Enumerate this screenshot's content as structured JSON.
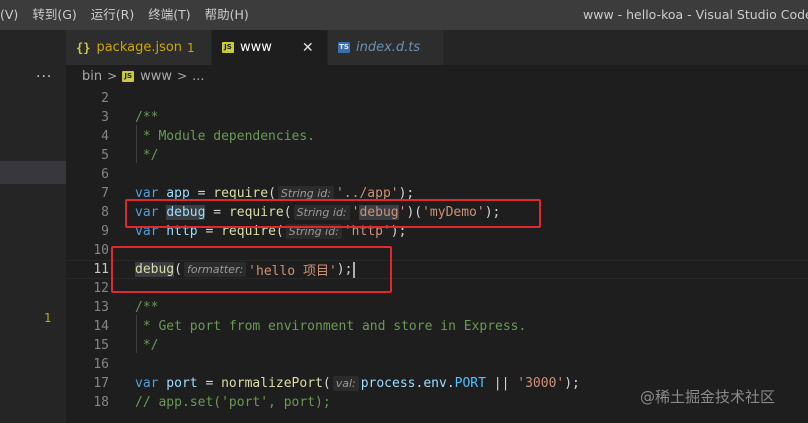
{
  "menu": {
    "items": [
      "(V)",
      "转到(G)",
      "运行(R)",
      "终端(T)",
      "帮助(H)"
    ]
  },
  "window_title": "www - hello-koa - Visual Studio Code [管",
  "sidebar": {
    "more_label": "···"
  },
  "tabs": [
    {
      "icon": "{}",
      "label": "package.json",
      "badge": "1"
    },
    {
      "icon": "JS",
      "label": "www",
      "close": "✕"
    },
    {
      "icon": "TS",
      "label": "index.d.ts"
    }
  ],
  "breadcrumb": {
    "root": "bin",
    "sep1": ">",
    "file_icon": "JS",
    "file": "www",
    "sep2": ">",
    "tail": "..."
  },
  "gutter_marker": "1",
  "code": {
    "ln2": "2",
    "ln3": "3",
    "l3_text": "/**",
    "ln4": "4",
    "l4_text": " * Module dependencies.",
    "ln5": "5",
    "l5_text": " */",
    "ln6": "6",
    "ln7": "7",
    "l7_var": "var",
    "l7_name": " app",
    "l7_eq": " = ",
    "l7_fn": "require",
    "l7_open": "(",
    "l7_hint": "String id:",
    "l7_str": "'../app'",
    "l7_close": ");",
    "ln8": "8",
    "l8_var": "var",
    "l8_name": "debug",
    "l8_eq": " = ",
    "l8_fn": "require",
    "l8_open": "(",
    "l8_hint": "String id:",
    "l8_q1": "'",
    "l8_strmid": "debug",
    "l8_q2": "'",
    "l8_call": ")(",
    "l8_str2": "'myDemo'",
    "l8_close": ");",
    "ln9": "9",
    "l9_var": "var",
    "l9_name": " http",
    "l9_eq": " = ",
    "l9_fn": "require",
    "l9_open": "(",
    "l9_hint": "String id:",
    "l9_str": "'http'",
    "l9_close": ");",
    "ln10": "10",
    "ln11": "11",
    "l11_fn": "debug",
    "l11_open": "(",
    "l11_hint": "formatter:",
    "l11_str": "'hello 项目'",
    "l11_close": ");",
    "ln12": "12",
    "ln13": "13",
    "l13_text": "/**",
    "ln14": "14",
    "l14_text": " * Get port from environment and store in Express.",
    "ln15": "15",
    "l15_text": " */",
    "ln16": "16",
    "ln17": "17",
    "l17_var": "var",
    "l17_name": " port",
    "l17_eq": " = ",
    "l17_fn": "normalizePort",
    "l17_open": "(",
    "l17_hint": "val:",
    "l17_obj": "process",
    "l17_dot1": ".",
    "l17_env": "env",
    "l17_dot2": ".",
    "l17_port": "PORT",
    "l17_or": " || ",
    "l17_str": "'3000'",
    "l17_close": ");",
    "ln18": "18",
    "l18_text": "// app.set('port', port);"
  },
  "watermark": "@稀土掘金技术社区",
  "colors": {
    "editor_bg": "#1e1e1e",
    "highlight_box": "#e0282e",
    "keyword": "#569cd6",
    "string": "#ce9178",
    "comment": "#6a9955"
  }
}
